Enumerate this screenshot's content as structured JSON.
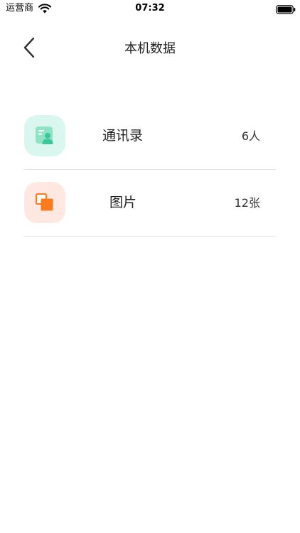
{
  "status_bar": {
    "carrier": "运营商",
    "time": "07:32",
    "wifi_icon": "wifi-icon",
    "battery_icon": "battery-icon"
  },
  "nav": {
    "back_icon": "chevron-left-icon",
    "title": "本机数据"
  },
  "items": [
    {
      "icon": "contacts-icon",
      "label": "通讯录",
      "count": "6人",
      "icon_bg": "#d9f7ee",
      "icon_color": "#3cc79a"
    },
    {
      "icon": "photos-icon",
      "label": "图片",
      "count": "12张",
      "icon_bg": "#ffe8e1",
      "icon_color": "#ff7a1a"
    }
  ]
}
